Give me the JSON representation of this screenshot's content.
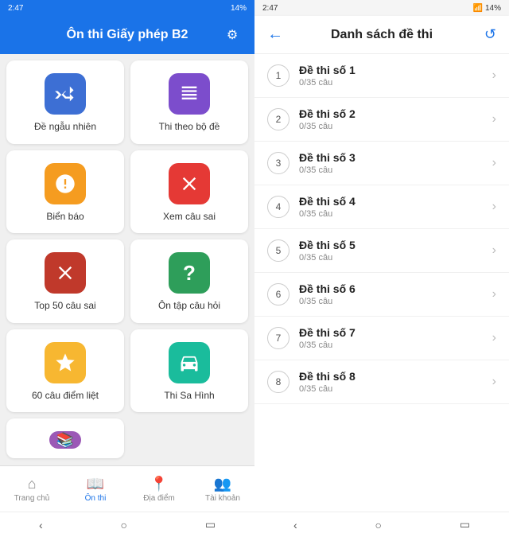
{
  "left_screen": {
    "status": {
      "time": "2:47",
      "battery": "14%",
      "signal": "▲▼"
    },
    "header": {
      "title": "Ôn thi Giấy phép B2",
      "settings_icon": "⚙"
    },
    "menu_items": [
      {
        "id": "de-ngau-nhien",
        "label": "Đề ngẫu nhiên",
        "icon": "⇄",
        "color": "bg-blue"
      },
      {
        "id": "thi-theo-bo-de",
        "label": "Thi theo bộ đề",
        "icon": "🗃",
        "color": "bg-purple"
      },
      {
        "id": "bien-bao",
        "label": "Biển báo",
        "icon": "🚦",
        "color": "bg-orange"
      },
      {
        "id": "xem-cau-sai",
        "label": "Xem câu sai",
        "icon": "✖",
        "color": "bg-red"
      },
      {
        "id": "top-50-cau-sai",
        "label": "Top 50 câu sai",
        "icon": "✖",
        "color": "bg-dark-red"
      },
      {
        "id": "on-tap-cau-hoi",
        "label": "Ôn tập câu hỏi",
        "icon": "?",
        "color": "bg-green"
      },
      {
        "id": "60-cau-diem-liet",
        "label": "60 câu điểm liệt",
        "icon": "★",
        "color": "bg-yellow"
      },
      {
        "id": "thi-sa-hinh",
        "label": "Thi Sa Hình",
        "icon": "🚗",
        "color": "bg-teal"
      }
    ],
    "bottom_nav": [
      {
        "id": "trang-chu",
        "label": "Trang chủ",
        "icon": "⌂",
        "active": false
      },
      {
        "id": "on-thi",
        "label": "Ôn thi",
        "icon": "📖",
        "active": true
      },
      {
        "id": "dia-diem",
        "label": "Địa điểm",
        "icon": "📍",
        "active": false
      },
      {
        "id": "tai-khoan",
        "label": "Tài khoản",
        "icon": "👥",
        "active": false
      }
    ]
  },
  "right_screen": {
    "status": {
      "time": "2:47",
      "battery": "14%"
    },
    "header": {
      "title": "Danh sách đề thi",
      "back_label": "←",
      "refresh_label": "↺"
    },
    "exam_list": [
      {
        "number": 1,
        "title": "Đề thi số 1",
        "sub": "0/35 câu"
      },
      {
        "number": 2,
        "title": "Đề thi số 2",
        "sub": "0/35 câu"
      },
      {
        "number": 3,
        "title": "Đề thi số 3",
        "sub": "0/35 câu"
      },
      {
        "number": 4,
        "title": "Đề thi số 4",
        "sub": "0/35 câu"
      },
      {
        "number": 5,
        "title": "Đề thi số 5",
        "sub": "0/35 câu"
      },
      {
        "number": 6,
        "title": "Đề thi số 6",
        "sub": "0/35 câu"
      },
      {
        "number": 7,
        "title": "Đề thi số 7",
        "sub": "0/35 câu"
      },
      {
        "number": 8,
        "title": "Đề thi số 8",
        "sub": "0/35 câu"
      }
    ]
  }
}
